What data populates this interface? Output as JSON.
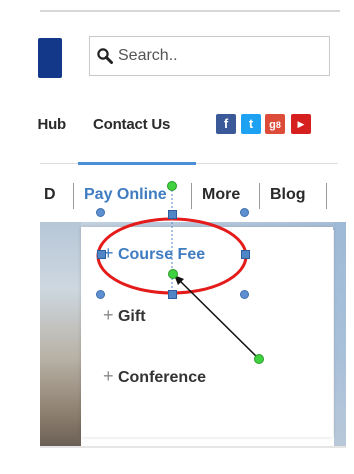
{
  "search": {
    "placeholder": "Search.."
  },
  "nav": {
    "partial_item": "Hub",
    "contact_label": "Contact Us"
  },
  "social": [
    {
      "name": "facebook",
      "glyph": "f",
      "color": "#3b5998"
    },
    {
      "name": "twitter",
      "glyph": "t",
      "color": "#1da1f2"
    },
    {
      "name": "google-plus",
      "glyph": "8",
      "color": "#dd4b39"
    },
    {
      "name": "youtube",
      "glyph": "▶",
      "color": "#d62020"
    }
  ],
  "menu": {
    "partial_item": "D",
    "pay_online": "Pay Online",
    "more": "More",
    "blog": "Blog"
  },
  "dropdown": {
    "items": [
      {
        "label": "Course Fee",
        "plus": "+"
      },
      {
        "label": "Gift",
        "plus": "+"
      },
      {
        "label": "Conference",
        "plus": "+"
      }
    ]
  },
  "colors": {
    "accent_blue": "#3f7cc0",
    "annotation_red": "#e31b1b",
    "annotation_green": "#3fd13f",
    "text_dark": "#2a2a2a"
  }
}
